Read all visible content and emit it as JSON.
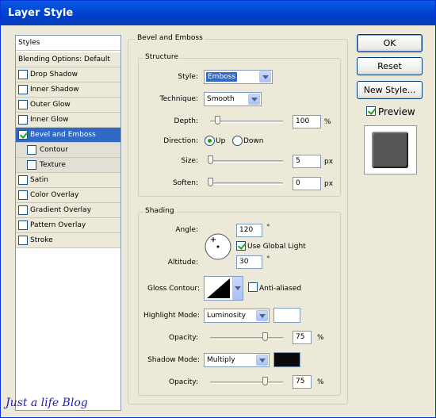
{
  "window": {
    "title": "Layer Style"
  },
  "styles_list": {
    "header": "Styles",
    "blending": "Blending Options: Default",
    "items": [
      {
        "label": "Drop Shadow",
        "checked": false
      },
      {
        "label": "Inner Shadow",
        "checked": false
      },
      {
        "label": "Outer Glow",
        "checked": false
      },
      {
        "label": "Inner Glow",
        "checked": false
      },
      {
        "label": "Bevel and Emboss",
        "checked": true
      },
      {
        "label": "Contour",
        "checked": false
      },
      {
        "label": "Texture",
        "checked": false
      },
      {
        "label": "Satin",
        "checked": false
      },
      {
        "label": "Color Overlay",
        "checked": false
      },
      {
        "label": "Gradient Overlay",
        "checked": false
      },
      {
        "label": "Pattern Overlay",
        "checked": false
      },
      {
        "label": "Stroke",
        "checked": false
      }
    ]
  },
  "bevel": {
    "title": "Bevel and Emboss",
    "structure": {
      "title": "Structure",
      "style_label": "Style:",
      "style_value": "Emboss",
      "technique_label": "Technique:",
      "technique_value": "Smooth",
      "depth_label": "Depth:",
      "depth_value": "100",
      "depth_unit": "%",
      "depth_level": 0.1,
      "direction_label": "Direction:",
      "direction_up": "Up",
      "direction_down": "Down",
      "direction_selected": "Up",
      "size_label": "Size:",
      "size_value": "5",
      "size_unit": "px",
      "size_level": 0.0,
      "soften_label": "Soften:",
      "soften_value": "0",
      "soften_unit": "px",
      "soften_level": 0.0
    },
    "shading": {
      "title": "Shading",
      "angle_label": "Angle:",
      "angle_value": "120",
      "angle_unit": "°",
      "global_light_label": "Use Global Light",
      "global_light_checked": true,
      "altitude_label": "Altitude:",
      "altitude_value": "30",
      "altitude_unit": "°",
      "gloss_label": "Gloss Contour:",
      "anti_aliased_label": "Anti-aliased",
      "anti_aliased_checked": false,
      "highlight_mode_label": "Highlight Mode:",
      "highlight_mode_value": "Luminosity",
      "highlight_color": "#ffffff",
      "highlight_opacity_label": "Opacity:",
      "highlight_opacity_value": "75",
      "highlight_opacity_unit": "%",
      "highlight_opacity_level": 0.75,
      "shadow_mode_label": "Shadow Mode:",
      "shadow_mode_value": "Multiply",
      "shadow_color": "#000000",
      "shadow_opacity_label": "Opacity:",
      "shadow_opacity_value": "75",
      "shadow_opacity_unit": "%",
      "shadow_opacity_level": 0.75
    }
  },
  "buttons": {
    "ok": "OK",
    "reset": "Reset",
    "new_style": "New Style...",
    "preview_label": "Preview",
    "preview_checked": true
  },
  "watermark": "Just a life Blog",
  "colors": {
    "accent": "#316ac5",
    "titlebar": "#0054e3",
    "checkmark": "#21a121"
  }
}
